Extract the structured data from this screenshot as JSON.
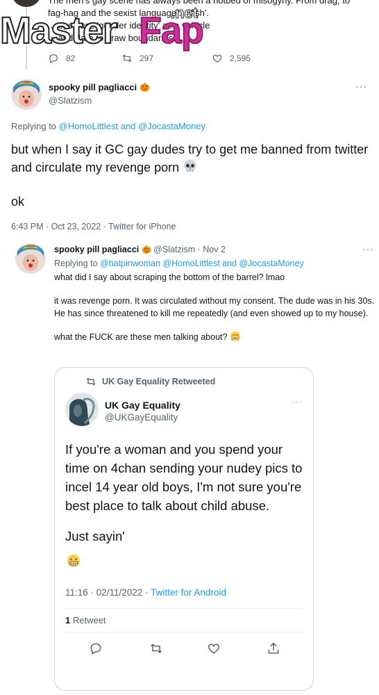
{
  "top_tweet": {
    "lines": [
      "The men's gay scene has always been a hotbed of misogyny. From drag, to",
      "fag-hag and the sexist language ... 'fish'.",
      "... ones use 'gender identity'  as a vehicle",
      "... and dare to draw boundaries"
    ],
    "replies": "82",
    "retweets": "297",
    "likes": "2,595"
  },
  "watermark": {
    "master": "Master",
    "fap": "Fap",
    "net": ".net"
  },
  "main_tweet": {
    "display_name": "spooky pill pagliacci",
    "handle": "@Slatzism",
    "more": "···",
    "replying_prefix": "Replying to ",
    "replying_users": "@HomoLittlest and @JocastaMoney",
    "body": "but when I say it GC gay dudes try to get me banned from twitter and circulate my revenge porn",
    "body_emoji": "skull-emoji",
    "ok": "ok",
    "meta": "6:43 PM · Oct 23, 2022 · Twitter for iPhone"
  },
  "reply_tweet": {
    "display_name": "spooky pill pagliacci",
    "name_emoji": "jack-o-lantern-emoji",
    "handle_date": "@Slatzism · Nov 2",
    "more": "···",
    "replying_prefix": "Replying to ",
    "replying_users": "@hatpinwoman @HomoLittlest and @JocastaMoney",
    "paragraphs": [
      "what did I say about scraping the bottom of the barrel? lmao",
      "it was revenge porn. It was circulated without my consent. The dude was in his 30s. He has since threatened to kill me repeatedly (and even showed up to my house).",
      "what the FUCK are these men talking about?"
    ],
    "last_emoji": "crying-face-emoji"
  },
  "embed": {
    "retweeted_by": "UK Gay Equality Retweeted",
    "display_name": "UK Gay Equality",
    "handle": "@UKGayEquality",
    "more": "···",
    "text": "If you're a woman and you spend your time on 4chan sending your nudey pics to incel 14 year old boys, I'm not sure you're best place to talk about child abuse.",
    "text2": "Just sayin'",
    "emoji": "grimacing-face-emoji",
    "time": "11:16 · 02/11/2022 · ",
    "source": "Twitter for Android",
    "retweet_count": "1",
    "retweet_label": " Retweet"
  },
  "colors": {
    "text": "#0f1419",
    "muted": "#536471",
    "link": "#1d9bf0",
    "border": "#cfd9de",
    "watermark_accent": "#cf2e9a"
  }
}
